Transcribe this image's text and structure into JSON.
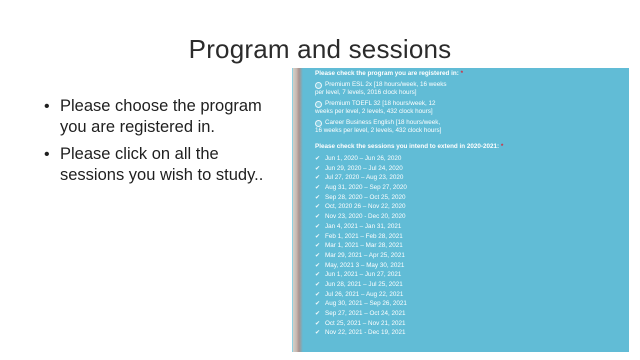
{
  "slide": {
    "title": "Program and sessions",
    "bullets": [
      "Please choose the program you are registered in.",
      "Please click on all the sessions you wish to study.."
    ]
  },
  "form": {
    "program_question": "Please check the program you are registered in:",
    "required_mark": "*",
    "programs": [
      {
        "line1": "Premium ESL 2x [18 hours/week, 16 weeks",
        "line2": "per level, 7 levels, 2016 clock hours]"
      },
      {
        "line1": "Premium TOEFL 32 [18 hours/week, 12",
        "line2": "weeks per level, 2 levels, 432 clock hours]"
      },
      {
        "line1": "Career Business English [18 hours/week,",
        "line2": "16 weeks per level, 2 levels, 432 clock hours]"
      }
    ],
    "sessions_question": "Please check the sessions you intend to extend in 2020-2021:",
    "sessions": [
      "Jun 1, 2020 – Jun 26, 2020",
      "Jun 29, 2020 – Jul 24, 2020",
      "Jul 27, 2020 – Aug 23, 2020",
      "Aug 31, 2020 – Sep 27, 2020",
      "Sep 28, 2020 – Oct 25, 2020",
      "Oct, 2020 26 – Nov 22, 2020",
      "Nov 23, 2020 - Dec 20, 2020",
      "Jan 4, 2021 – Jan 31, 2021",
      "Feb 1, 2021 – Feb 28, 2021",
      "Mar 1, 2021 – Mar 28, 2021",
      "Mar 29, 2021 – Apr 25, 2021",
      "May, 2021 3 – May 30, 2021",
      "Jun 1, 2021 – Jun 27, 2021",
      "Jun 28, 2021 – Jul 25, 2021",
      "Jul 26, 2021 – Aug 22, 2021",
      "Aug 30, 2021 – Sep 26, 2021",
      "Sep 27, 2021 – Oct 24, 2021",
      "Oct 25, 2021 – Nov 21, 2021",
      "Nov 22, 2021 - Dec 19, 2021"
    ],
    "colors": {
      "panel_bg": "#61bcd6",
      "text": "#ffffff",
      "required": "#d6283a"
    },
    "icons": {
      "program_option": "radio-icon",
      "session_option": "checkmark-icon"
    }
  }
}
